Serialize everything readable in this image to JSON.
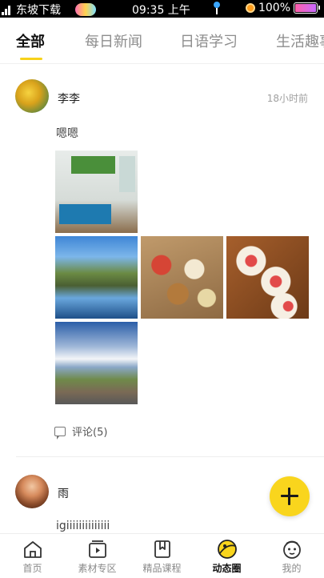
{
  "status_bar": {
    "carrier": "东坡下载",
    "time": "09:35 上午",
    "battery": "100%"
  },
  "tabs": [
    {
      "label": "全部",
      "active": true
    },
    {
      "label": "每日新闻",
      "active": false
    },
    {
      "label": "日语学习",
      "active": false
    },
    {
      "label": "生活趣事",
      "active": false
    }
  ],
  "posts": [
    {
      "author": "李李",
      "time": "18小时前",
      "text": "嗯嗯",
      "photo_count": 5,
      "comment_label": "评论(5)"
    },
    {
      "author": "雨",
      "text": "igiiiiiiiiiiiiii"
    }
  ],
  "fab": {
    "icon": "plus-icon"
  },
  "bottom_nav": [
    {
      "label": "首页",
      "icon": "home-icon",
      "active": false
    },
    {
      "label": "素材专区",
      "icon": "material-icon",
      "active": false
    },
    {
      "label": "精品课程",
      "icon": "bookmark-icon",
      "active": false
    },
    {
      "label": "动态圈",
      "icon": "moments-icon",
      "active": true
    },
    {
      "label": "我的",
      "icon": "profile-icon",
      "active": false
    }
  ],
  "colors": {
    "accent": "#f9d51d",
    "tab_active": "#111111",
    "tab_inactive": "#8d8d8d"
  }
}
